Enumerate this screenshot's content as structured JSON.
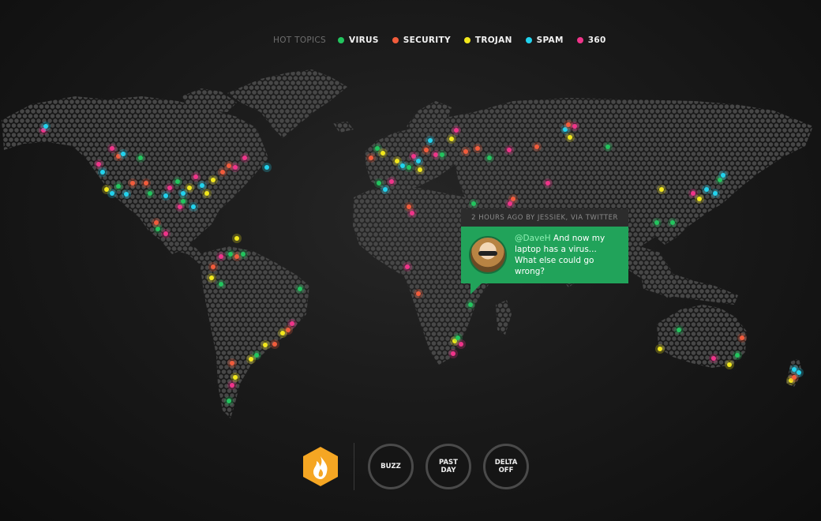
{
  "legend": {
    "label": "HOT TOPICS",
    "topics": [
      {
        "name": "VIRUS",
        "color": "#22c55e"
      },
      {
        "name": "SECURITY",
        "color": "#f25c3c"
      },
      {
        "name": "TROJAN",
        "color": "#f2e81c"
      },
      {
        "name": "SPAM",
        "color": "#22d3ee"
      },
      {
        "name": "360",
        "color": "#f0348a"
      }
    ]
  },
  "tooltip": {
    "header": "2 HOURS AGO BY JESSIEK, VIA TWITTER",
    "handle": "@DaveH",
    "message": " And now my laptop has a virus... What else could go wrong?"
  },
  "controls": {
    "fire_icon": "fire-icon",
    "buttons": [
      {
        "label": "BUZZ"
      },
      {
        "label": "PAST\nDAY"
      },
      {
        "label": "DELTA\nOFF"
      }
    ]
  },
  "colors": {
    "background": "#1a1a1a",
    "map_dot": "#474747",
    "accent_orange": "#f5a623",
    "tooltip_green": "#21a35a"
  }
}
